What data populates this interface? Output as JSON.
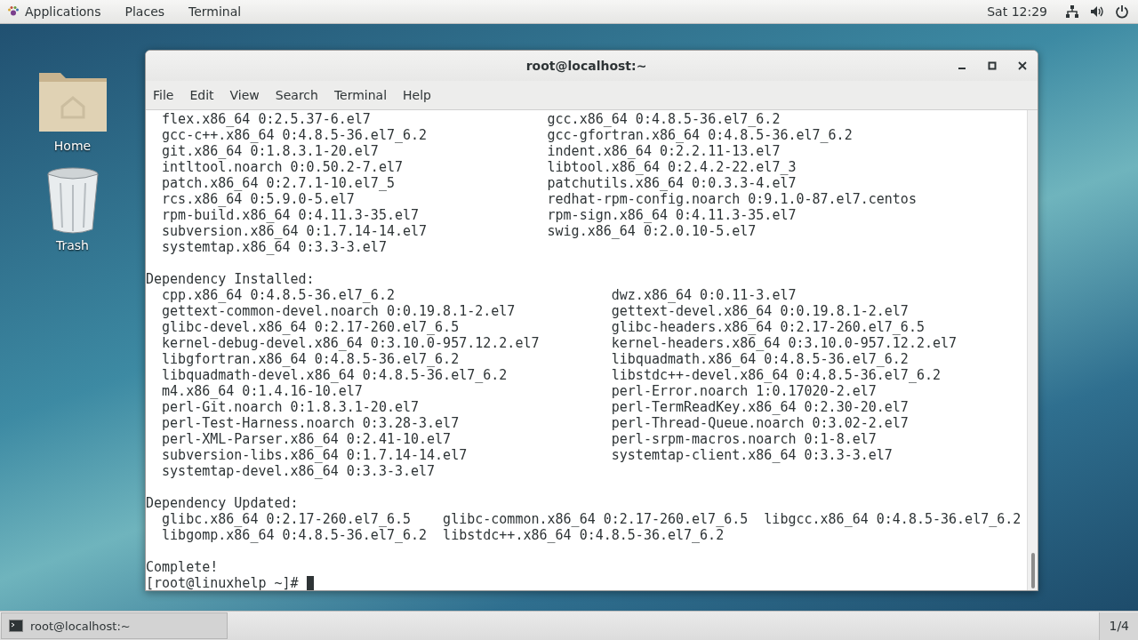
{
  "top_bar": {
    "menus": [
      "Applications",
      "Places",
      "Terminal"
    ],
    "clock": "Sat 12:29"
  },
  "desktop_icons": [
    {
      "kind": "folder",
      "label": "Home"
    },
    {
      "kind": "trash",
      "label": "Trash"
    }
  ],
  "window": {
    "title": "root@localhost:~"
  },
  "menu_bar": [
    "File",
    "Edit",
    "View",
    "Search",
    "Terminal",
    "Help"
  ],
  "terminal": {
    "sections": [
      {
        "rows": [
          [
            "flex.x86_64 0:2.5.37-6.el7",
            "gcc.x86_64 0:4.8.5-36.el7_6.2"
          ],
          [
            "gcc-c++.x86_64 0:4.8.5-36.el7_6.2",
            "gcc-gfortran.x86_64 0:4.8.5-36.el7_6.2"
          ],
          [
            "git.x86_64 0:1.8.3.1-20.el7",
            "indent.x86_64 0:2.2.11-13.el7"
          ],
          [
            "intltool.noarch 0:0.50.2-7.el7",
            "libtool.x86_64 0:2.4.2-22.el7_3"
          ],
          [
            "patch.x86_64 0:2.7.1-10.el7_5",
            "patchutils.x86_64 0:0.3.3-4.el7"
          ],
          [
            "rcs.x86_64 0:5.9.0-5.el7",
            "redhat-rpm-config.noarch 0:9.1.0-87.el7.centos"
          ],
          [
            "rpm-build.x86_64 0:4.11.3-35.el7",
            "rpm-sign.x86_64 0:4.11.3-35.el7"
          ],
          [
            "subversion.x86_64 0:1.7.14-14.el7",
            "swig.x86_64 0:2.0.10-5.el7"
          ],
          [
            "systemtap.x86_64 0:3.3-3.el7"
          ]
        ]
      },
      {
        "heading": "Dependency Installed:",
        "rows": [
          [
            "cpp.x86_64 0:4.8.5-36.el7_6.2",
            "dwz.x86_64 0:0.11-3.el7"
          ],
          [
            "gettext-common-devel.noarch 0:0.19.8.1-2.el7",
            "gettext-devel.x86_64 0:0.19.8.1-2.el7"
          ],
          [
            "glibc-devel.x86_64 0:2.17-260.el7_6.5",
            "glibc-headers.x86_64 0:2.17-260.el7_6.5"
          ],
          [
            "kernel-debug-devel.x86_64 0:3.10.0-957.12.2.el7",
            "kernel-headers.x86_64 0:3.10.0-957.12.2.el7"
          ],
          [
            "libgfortran.x86_64 0:4.8.5-36.el7_6.2",
            "libquadmath.x86_64 0:4.8.5-36.el7_6.2"
          ],
          [
            "libquadmath-devel.x86_64 0:4.8.5-36.el7_6.2",
            "libstdc++-devel.x86_64 0:4.8.5-36.el7_6.2"
          ],
          [
            "m4.x86_64 0:1.4.16-10.el7",
            "perl-Error.noarch 1:0.17020-2.el7"
          ],
          [
            "perl-Git.noarch 0:1.8.3.1-20.el7",
            "perl-TermReadKey.x86_64 0:2.30-20.el7"
          ],
          [
            "perl-Test-Harness.noarch 0:3.28-3.el7",
            "perl-Thread-Queue.noarch 0:3.02-2.el7"
          ],
          [
            "perl-XML-Parser.x86_64 0:2.41-10.el7",
            "perl-srpm-macros.noarch 0:1-8.el7"
          ],
          [
            "subversion-libs.x86_64 0:1.7.14-14.el7",
            "systemtap-client.x86_64 0:3.3-3.el7"
          ],
          [
            "systemtap-devel.x86_64 0:3.3-3.el7"
          ]
        ]
      },
      {
        "heading": "Dependency Updated:",
        "rows": [
          [
            "glibc.x86_64 0:2.17-260.el7_6.5",
            "glibc-common.x86_64 0:2.17-260.el7_6.5",
            "libgcc.x86_64 0:4.8.5-36.el7_6.2"
          ],
          [
            "libgomp.x86_64 0:4.8.5-36.el7_6.2",
            "libstdc++.x86_64 0:4.8.5-36.el7_6.2"
          ]
        ]
      }
    ],
    "status": "Complete!",
    "prompt": "[root@linuxhelp ~]#"
  },
  "taskbar": {
    "item": "root@localhost:~",
    "workspace": "1/4"
  }
}
